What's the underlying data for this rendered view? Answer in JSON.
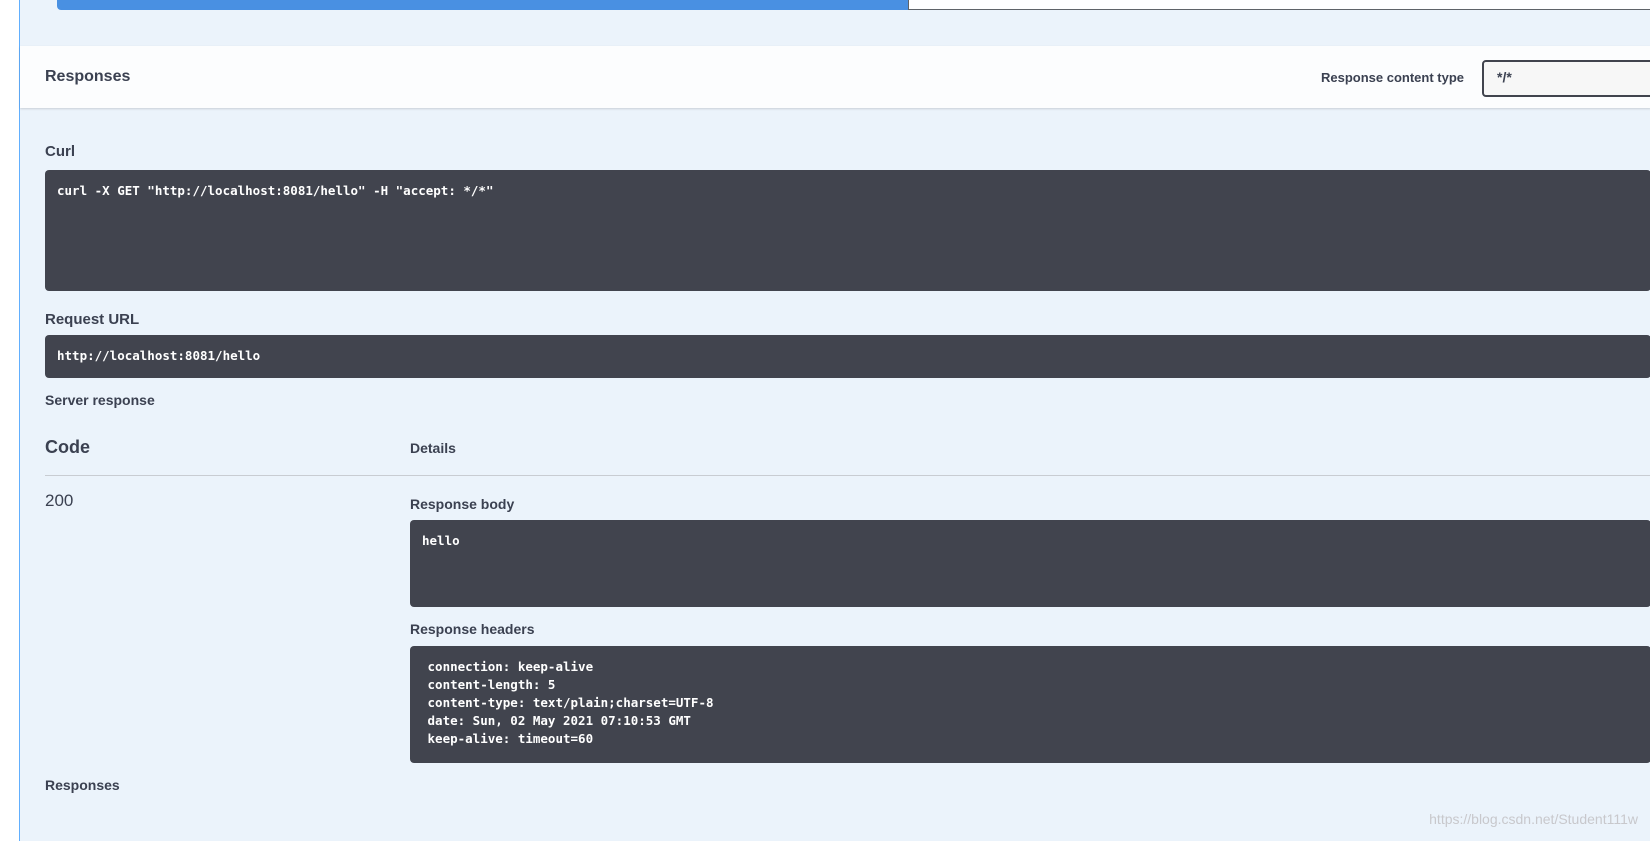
{
  "responses_header": {
    "title": "Responses",
    "content_type_label": "Response content type",
    "content_type_value": "*/*"
  },
  "curl": {
    "label": "Curl",
    "command": "curl -X GET \"http://localhost:8081/hello\" -H \"accept: */*\""
  },
  "request_url": {
    "label": "Request URL",
    "value": "http://localhost:8081/hello"
  },
  "server_response": {
    "label": "Server response",
    "code_header": "Code",
    "details_header": "Details",
    "status_code": "200",
    "body_label": "Response body",
    "body": "hello",
    "headers_label": "Response headers",
    "headers": " connection: keep-alive\n content-length: 5\n content-type: text/plain;charset=UTF-8\n date: Sun, 02 May 2021 07:10:53 GMT\n keep-alive: timeout=60"
  },
  "footer": {
    "responses_label": "Responses"
  },
  "watermark": "https://blog.csdn.net/Student111w",
  "colors": {
    "execute_blue": "#4990e2",
    "panel_bg": "#ebf3fb",
    "code_bg": "#41444e",
    "text": "#3b4151"
  }
}
